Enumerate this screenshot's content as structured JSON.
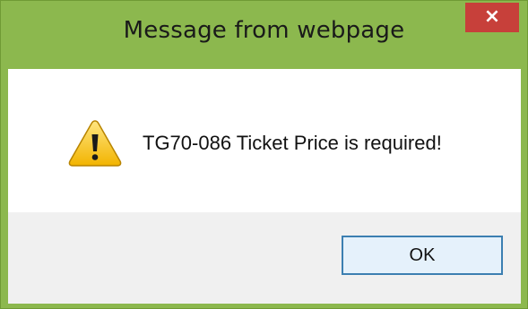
{
  "window": {
    "title": "Message from webpage",
    "close_glyph": "×",
    "close_button_color": "#c7403a",
    "frame_color": "#8cb84e"
  },
  "dialog": {
    "icon": "warning-icon",
    "message": "TG70-086 Ticket Price is required!",
    "ok_label": "OK"
  }
}
